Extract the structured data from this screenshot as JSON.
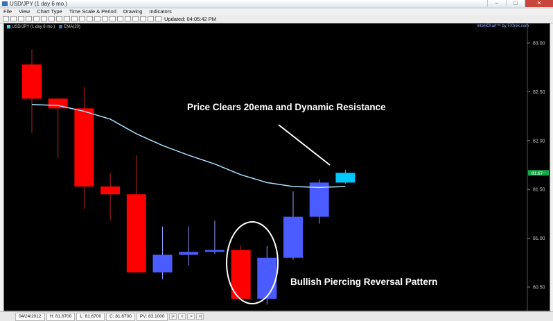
{
  "window": {
    "title": "USD/JPY (1 day  6 mo.)",
    "controls": [
      "–",
      "□",
      "✕"
    ]
  },
  "menu": [
    "File",
    "View",
    "Chart Type",
    "Time Scale & Period",
    "Drawing",
    "Indicators"
  ],
  "toolbar": {
    "updated": "Updated: 04:05:42 PM"
  },
  "chart_header": {
    "symbol": "USD/JPY (1 day  6 mo.)",
    "indicator": "EMA(20)",
    "brand": "IntelliChart™ by FXtrek.com"
  },
  "colors": {
    "bullish": "#4a5cff",
    "bearish": "#ff0000",
    "last": "#00c8ff",
    "ema": "#a8e2ff"
  },
  "chart_data": {
    "type": "candlestick",
    "y_ticks": [
      80.5,
      81.0,
      81.5,
      82.0,
      82.5,
      83.0
    ],
    "y_tick_labels": [
      "80.50",
      "81.00",
      "81.50",
      "82.00",
      "82.50",
      "83.00"
    ],
    "ylim": [
      80.3,
      83.1
    ],
    "last_price": 81.67,
    "last_price_label": "81.67",
    "candles": [
      {
        "o": 82.78,
        "h": 82.93,
        "l": 82.08,
        "c": 82.43
      },
      {
        "o": 82.43,
        "h": 82.43,
        "l": 81.82,
        "c": 82.33
      },
      {
        "o": 82.33,
        "h": 82.55,
        "l": 81.3,
        "c": 81.53
      },
      {
        "o": 81.53,
        "h": 81.67,
        "l": 81.18,
        "c": 81.45
      },
      {
        "o": 81.45,
        "h": 81.85,
        "l": 80.65,
        "c": 80.65
      },
      {
        "o": 80.65,
        "h": 81.12,
        "l": 80.58,
        "c": 80.83
      },
      {
        "o": 80.83,
        "h": 81.12,
        "l": 80.72,
        "c": 80.86
      },
      {
        "o": 80.86,
        "h": 81.18,
        "l": 80.84,
        "c": 80.88
      },
      {
        "o": 80.88,
        "h": 80.93,
        "l": 80.38,
        "c": 80.38
      },
      {
        "o": 80.38,
        "h": 80.92,
        "l": 80.32,
        "c": 80.8
      },
      {
        "o": 80.8,
        "h": 81.48,
        "l": 80.78,
        "c": 81.22
      },
      {
        "o": 81.22,
        "h": 81.6,
        "l": 81.15,
        "c": 81.57
      },
      {
        "o": 81.57,
        "h": 81.7,
        "l": 81.56,
        "c": 81.67
      }
    ],
    "ema20": [
      82.37,
      82.36,
      82.3,
      82.22,
      82.07,
      81.95,
      81.85,
      81.76,
      81.65,
      81.57,
      81.53,
      81.52,
      81.53
    ],
    "annotations": [
      {
        "text": "Price Clears 20ema and Dynamic Resistance"
      },
      {
        "text": "Bullish Piercing Reversal Pattern"
      }
    ]
  },
  "status": {
    "date": "04/24/2012",
    "high": "H: 81.6700",
    "low": "L: 81.6700",
    "close": "C: 81.6700",
    "pv": "PV: 83.1000"
  }
}
